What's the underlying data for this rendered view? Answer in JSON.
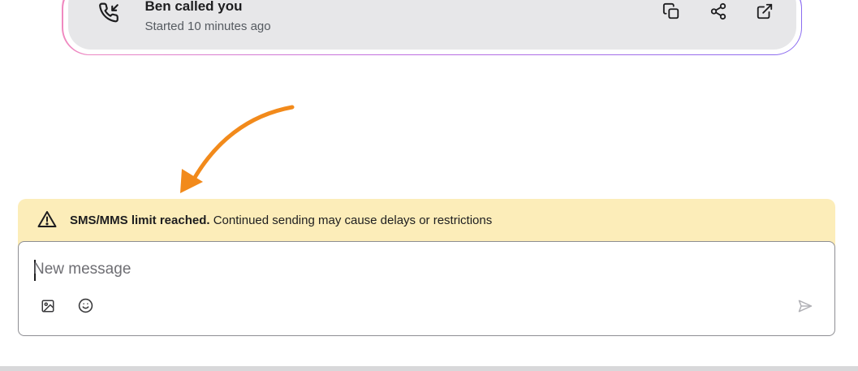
{
  "call_card": {
    "title": "Ben called you",
    "subtitle": "Started 10 minutes ago",
    "icon": "incoming-call-icon",
    "actions": [
      {
        "name": "copy",
        "icon": "copy-icon"
      },
      {
        "name": "share",
        "icon": "share-icon"
      },
      {
        "name": "open-external",
        "icon": "external-link-icon"
      }
    ]
  },
  "annotation": {
    "arrow_color": "#f28a1b",
    "icon": "curved-arrow-icon"
  },
  "warning": {
    "bold_text": "SMS/MMS limit reached.",
    "text": " Continued sending may cause delays or restrictions",
    "icon": "warning-triangle-icon",
    "background": "#fcedb9"
  },
  "composer": {
    "placeholder": "New message",
    "value": "",
    "tools": [
      {
        "name": "attach-image",
        "icon": "image-icon"
      },
      {
        "name": "emoji",
        "icon": "emoji-icon"
      }
    ],
    "send_icon": "send-icon"
  }
}
